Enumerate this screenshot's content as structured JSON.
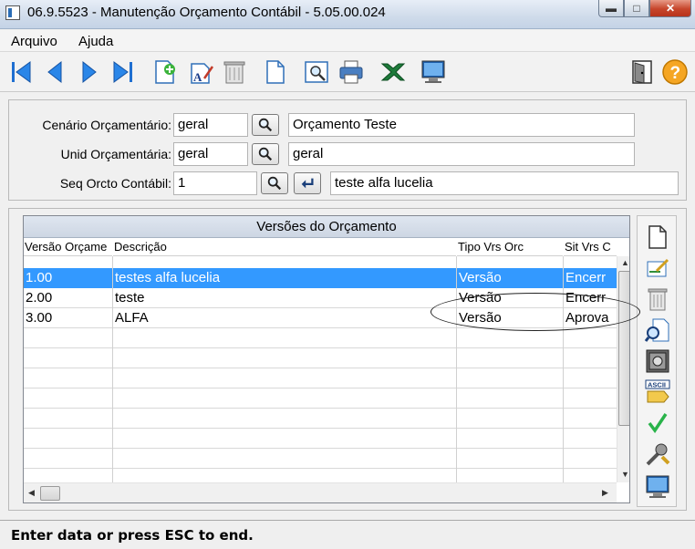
{
  "window": {
    "title": "06.9.5523 - Manutenção Orçamento Contábil - 5.05.00.024"
  },
  "menu": {
    "items": [
      "Arquivo",
      "Ajuda"
    ]
  },
  "toolbar": {
    "icons": [
      "first-record-icon",
      "previous-record-icon",
      "next-record-icon",
      "last-record-icon",
      "add-record-icon",
      "edit-record-icon",
      "delete-record-icon",
      "document-icon",
      "preview-icon",
      "print-icon",
      "excel-icon",
      "screen-icon",
      "exit-door-icon",
      "help-icon"
    ]
  },
  "form": {
    "cenario": {
      "label": "Cenário Orçamentário:",
      "code": "geral",
      "description": "Orçamento Teste"
    },
    "unid": {
      "label": "Unid Orçamentária:",
      "code": "geral",
      "description": "geral"
    },
    "seq": {
      "label": "Seq Orcto Contábil:",
      "code": "1",
      "description": "teste alfa lucelia"
    }
  },
  "grid": {
    "title": "Versões do Orçamento",
    "columns": [
      "Versão Orçame",
      "Descrição",
      "Tipo Vrs Orc",
      "Sit Vrs C"
    ],
    "rows": [
      {
        "versao": "1.00",
        "descricao": "testes alfa lucelia",
        "tipo": "Versão",
        "sit": "Encerr",
        "selected": true
      },
      {
        "versao": "2.00",
        "descricao": "teste",
        "tipo": "Versão",
        "sit": "Encerr",
        "selected": false
      },
      {
        "versao": "3.00",
        "descricao": "ALFA",
        "tipo": "Versão",
        "sit": "Aprova",
        "selected": false
      }
    ],
    "selection_color": "#3399ff"
  },
  "sidebar": {
    "icons": [
      "new-page-icon",
      "edit-pen-icon",
      "trash-icon",
      "search-doc-icon",
      "safe-icon",
      "ascii-icon",
      "check-icon",
      "tools-icon",
      "monitor-icon"
    ],
    "ascii_label": "ASCII"
  },
  "status": {
    "text": "Enter data or press ESC to end."
  }
}
